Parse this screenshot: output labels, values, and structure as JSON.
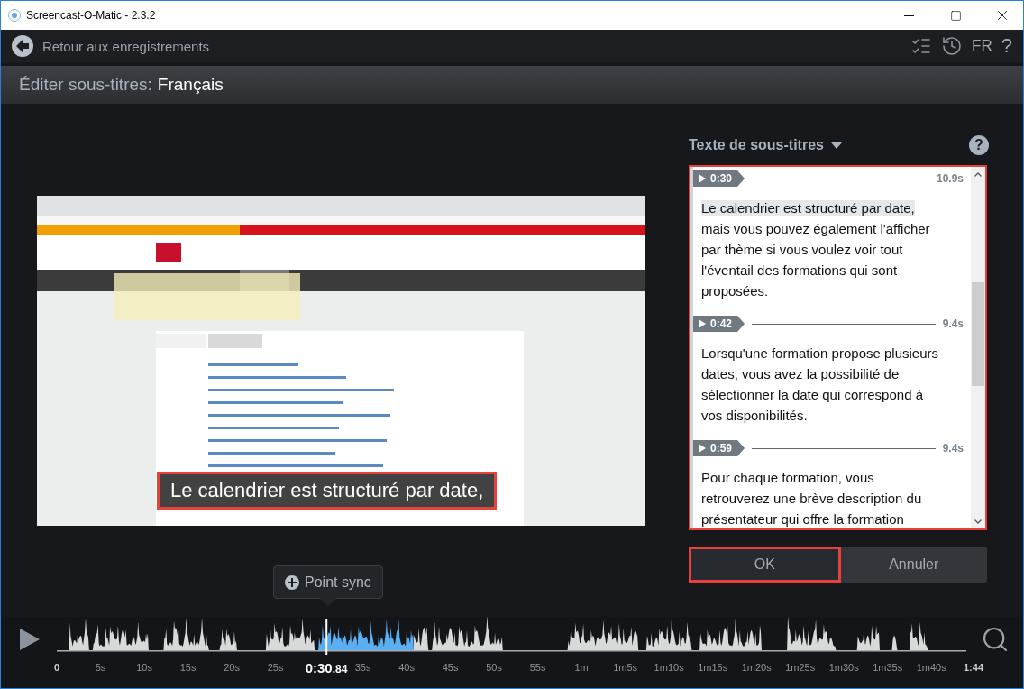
{
  "window": {
    "title": "Screencast-O-Matic - 2.3.2"
  },
  "toolbar": {
    "back_label": "Retour aux enregistrements",
    "language": "FR",
    "help": "?"
  },
  "header": {
    "label": "Éditer sous-titres:",
    "language": "Français"
  },
  "preview": {
    "kind": "picture",
    "caption": "Le calendrier est structuré par date,"
  },
  "subtitles": {
    "title": "Texte de sous-titres",
    "help": "?",
    "cues": [
      {
        "time": "0:30",
        "duration": "10.9s",
        "selected": true,
        "highlighted": "Le calendrier est structuré par date,",
        "text": "mais vous pouvez également l'afficher par thème si vous voulez voir tout l'éventail des formations qui sont proposées."
      },
      {
        "time": "0:42",
        "duration": "9.4s",
        "selected": false,
        "text": "Lorsqu'une formation propose plusieurs dates, vous avez la possibilité de sélectionner la date qui correspond à vos disponibilités."
      },
      {
        "time": "0:59",
        "duration": "9.4s",
        "selected": false,
        "text": "Pour chaque formation, vous retrouverez une brève description du présentateur qui offre la formation"
      }
    ],
    "buttons": [
      {
        "label": "OK",
        "selected": true
      },
      {
        "label": "Annuler",
        "selected": false
      }
    ]
  },
  "timeline": {
    "sync_label": "Point sync",
    "ticks": [
      {
        "label": "0",
        "kind": "start"
      },
      {
        "label": "5s",
        "kind": "tick"
      },
      {
        "label": "10s",
        "kind": "tick"
      },
      {
        "label": "15s",
        "kind": "tick"
      },
      {
        "label": "20s",
        "kind": "tick"
      },
      {
        "label": "25s",
        "kind": "tick"
      },
      {
        "kind": "current",
        "main": "0:30",
        "fraction": ".84"
      },
      {
        "label": "35s",
        "kind": "tick"
      },
      {
        "label": "40s",
        "kind": "tick"
      },
      {
        "label": "45s",
        "kind": "tick"
      },
      {
        "label": "50s",
        "kind": "tick"
      },
      {
        "label": "55s",
        "kind": "tick"
      },
      {
        "label": "1m",
        "kind": "tick"
      },
      {
        "label": "1m5s",
        "kind": "tick"
      },
      {
        "label": "1m10s",
        "kind": "tick"
      },
      {
        "label": "1m15s",
        "kind": "tick"
      },
      {
        "label": "1m20s",
        "kind": "tick"
      },
      {
        "label": "1m25s",
        "kind": "tick"
      },
      {
        "label": "1m30s",
        "kind": "tick"
      },
      {
        "label": "1m35s",
        "kind": "tick"
      },
      {
        "label": "1m40s",
        "kind": "tick"
      },
      {
        "label": "1:44",
        "kind": "end"
      }
    ]
  }
}
